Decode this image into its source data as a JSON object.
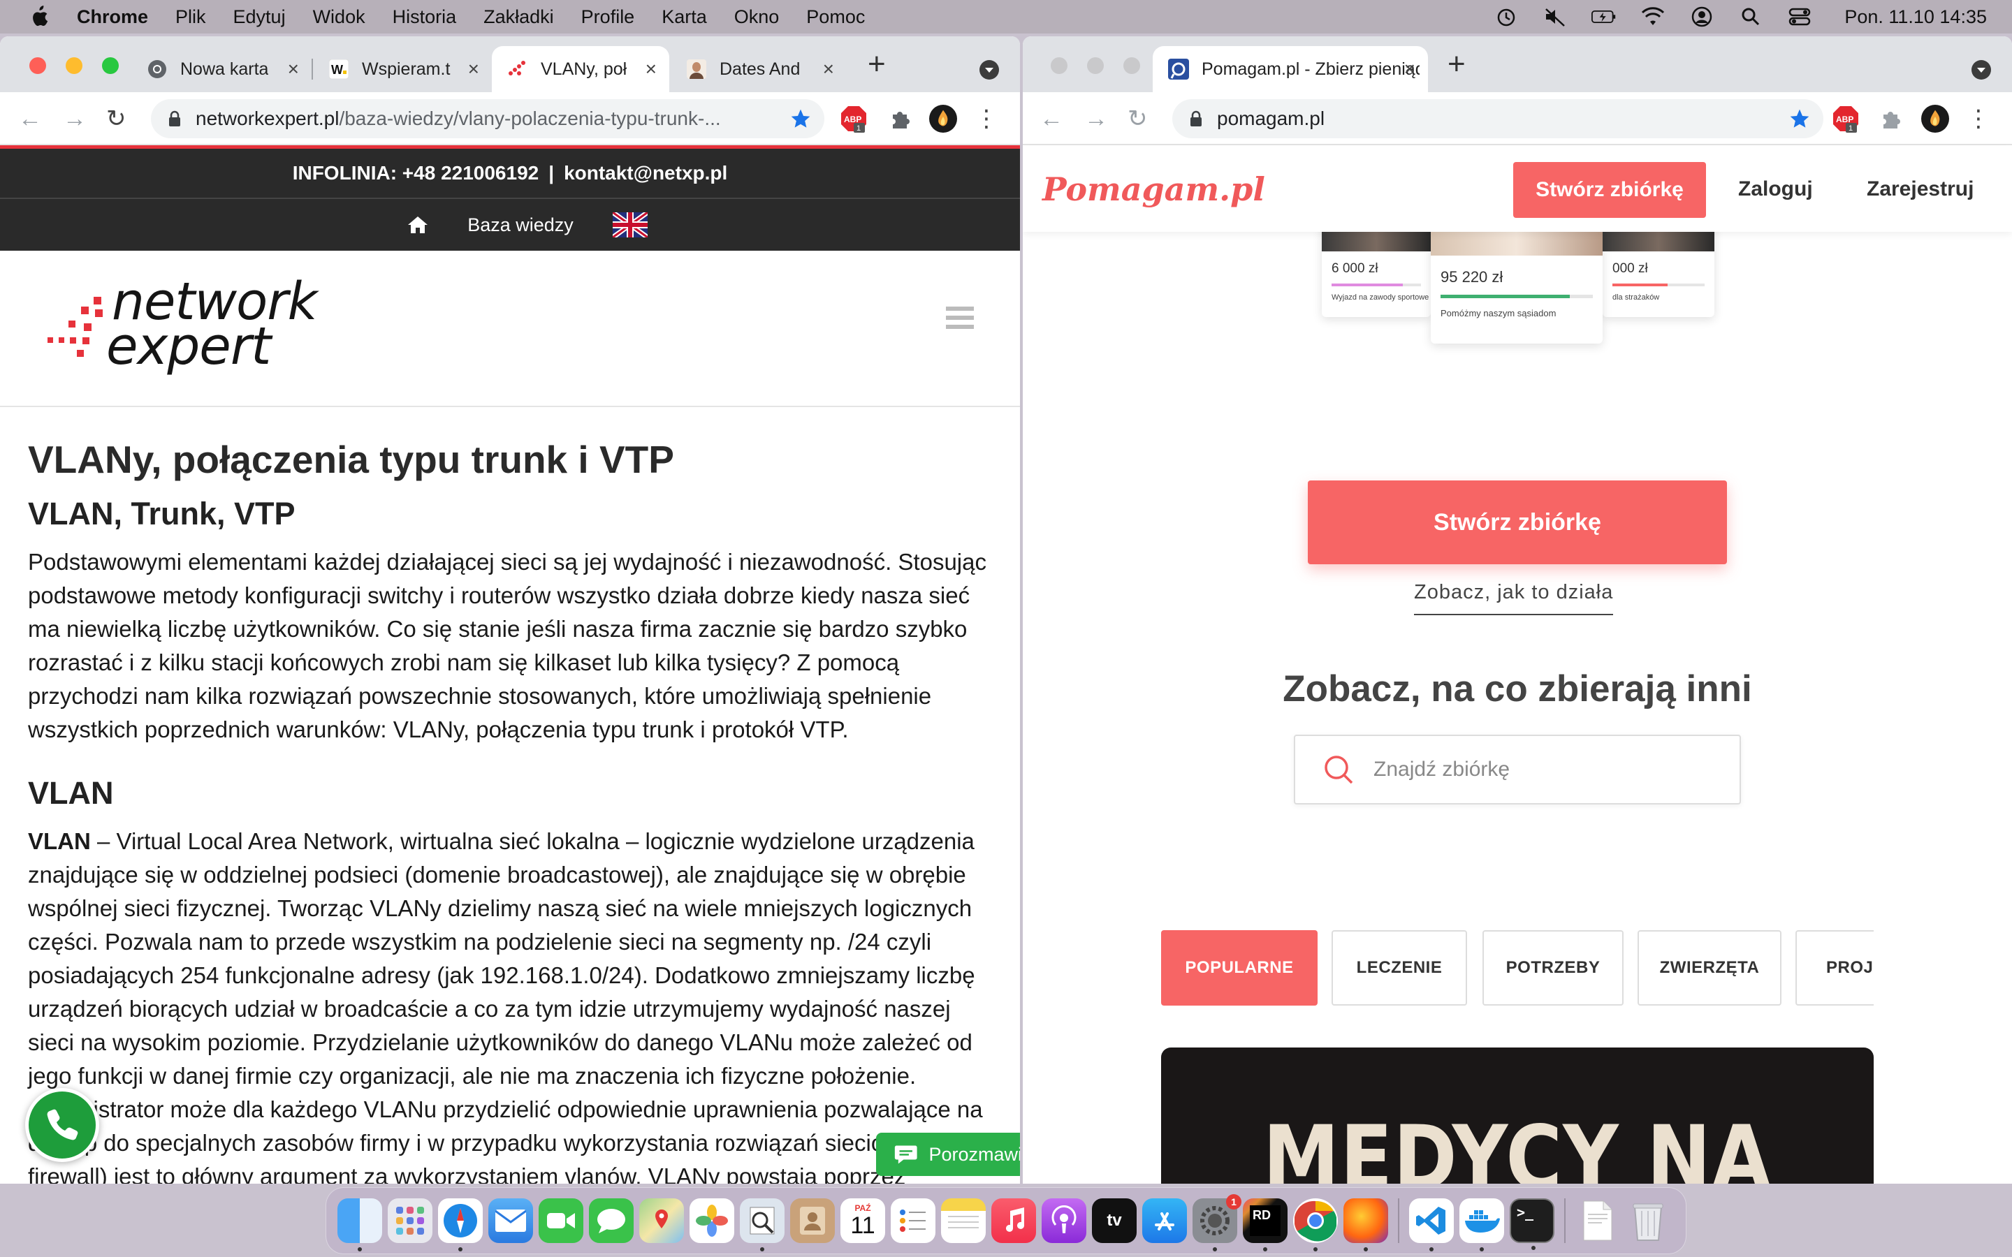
{
  "menubar": {
    "app_name": "Chrome",
    "items": [
      "Plik",
      "Edytuj",
      "Widok",
      "Historia",
      "Zakładki",
      "Profile",
      "Karta",
      "Okno",
      "Pomoc"
    ],
    "clock": "Pon. 11.10  14:35"
  },
  "left_window": {
    "tabs": [
      {
        "title": "Nowa karta",
        "icon": "chrome-icon"
      },
      {
        "title": "Wspieram.t",
        "icon": "wspieram-icon"
      },
      {
        "title": "VLANy, poł",
        "icon": "networkexpert-icon"
      },
      {
        "title": "Dates And",
        "icon": "profile-photo-icon"
      }
    ],
    "url_host": "networkexpert.pl",
    "url_path": "/baza-wiedzy/vlany-polaczenia-typu-trunk-...",
    "extension_badge": "1",
    "page": {
      "info_prefix": "INFOLINIA: +48 221006192",
      "info_divider": "|",
      "info_email": "kontakt@netxp.pl",
      "nav_link": "Baza wiedzy",
      "logo_word1": "network",
      "logo_word2": "expert",
      "title": "VLANy, połączenia typu trunk i VTP",
      "subtitle": "VLAN, Trunk, VTP",
      "intro": "Podstawowymi elementami każdej działającej sieci są jej wydajność i niezawodność. Stosując podstawowe metody konfiguracji switchy i routerów wszystko działa dobrze kiedy nasza sieć ma niewielką liczbę użytkowników. Co się stanie jeśli nasza firma zacznie się bardzo szybko rozrastać i z kilku stacji końcowych zrobi nam się kilkaset lub kilka tysięcy? Z pomocą przychodzi nam kilka rozwiązań powszechnie stosowanych, które umożliwiają spełnienie wszystkich poprzednich warunków: VLANy, połączenia typu trunk i protokół VTP.",
      "section_heading": "VLAN",
      "section_term": "VLAN",
      "section_body": " – Virtual Local Area Network, wirtualna sieć lokalna – logicznie wydzielone urządzenia znajdujące się w oddzielnej podsieci (domenie broadcastowej), ale znajdujące się w obrębie wspólnej sieci fizycznej. Tworząc VLANy dzielimy naszą sieć na wiele mniejszych logicznych części. Pozwala nam to przede wszystkim na podzielenie sieci na segmenty np. /24 czyli posiadających 254 funkcjonalne adresy (jak 192.168.1.0/24). Dodatkowo zmniejszamy liczbę urządzeń biorących udział w broadcaście a co za tym idzie utrzymujemy wydajność naszej sieci na wysokim poziomie. Przydzielanie użytkowników do danego VLANu może zależeć od jego funkcji w danej firmie czy organizacji, ale nie ma znaczenia ich fizyczne położenie. Administrator może dla każdego VLANu przydzielić odpowiednie uprawnienia pozwalające na dostęp do specjalnych zasobów firmy i w przypadku wykorzystania rozwiązań sieciowych (np. firewall) jest to główny argument za wykorzystaniem vlanów. VLANy powstają poprzez",
      "chat_label": "Porozmawiaj"
    }
  },
  "right_window": {
    "tabs": [
      {
        "title": "Pomagam.pl - Zbierz pieniądze",
        "icon": "pomagam-icon"
      }
    ],
    "url": "pomagam.pl",
    "extension_badge": "1",
    "page": {
      "logo": "Pomagam.pl",
      "create_top": "Stwórz zbiórkę",
      "login": "Zaloguj",
      "register": "Zarejestruj",
      "cards": [
        {
          "amount": "6 000 zł",
          "caption": "Wyjazd na zawody sportowe",
          "progress": 0.8,
          "bar_color": "#e08be0"
        },
        {
          "amount": "95 220 zł",
          "caption": "Pomóżmy naszym sąsiadom",
          "progress": 0.85,
          "bar_color": "#3fb070"
        },
        {
          "amount": "000 zł",
          "caption": "dla strażaków",
          "progress": 0.6,
          "bar_color": "#f76565"
        }
      ],
      "create_main": "Stwórz zbiórkę",
      "how_it_works": "Zobacz, jak to działa",
      "see_heading": "Zobacz, na co zbierają inni",
      "search_placeholder": "Znajdź zbiórkę",
      "categories": [
        "POPULARNE",
        "LECZENIE",
        "POTRZEBY",
        "ZWIERZĘTA",
        "PROJEKTY"
      ],
      "banner_title": "MEDYCY NA GRANICY"
    }
  },
  "dock": {
    "calendar_month": "PAŹ",
    "calendar_day": "11",
    "settings_badge": "1",
    "tv_label": "tv",
    "rider_label": "RD",
    "apps": [
      "finder-icon",
      "launchpad-icon",
      "safari-icon",
      "mail-icon",
      "facetime-icon",
      "messages-icon",
      "maps-icon",
      "photos-icon",
      "preview-icon",
      "contacts-icon",
      "calendar-icon",
      "reminders-icon",
      "notes-icon",
      "music-icon",
      "podcasts-icon",
      "apple-tv-icon",
      "app-store-icon",
      "system-preferences-icon",
      "rider-icon",
      "chrome-icon",
      "firefox-icon",
      "vscode-icon",
      "docker-icon",
      "terminal-icon",
      "pdf-document-icon",
      "trash-icon"
    ]
  }
}
